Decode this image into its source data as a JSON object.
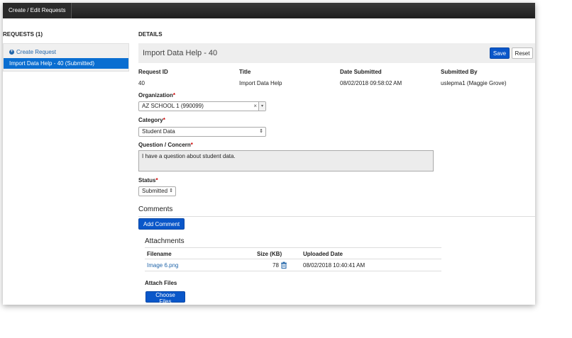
{
  "topbar": {
    "tab": "Create / Edit Requests"
  },
  "left": {
    "heading": "REQUESTS (1)",
    "create_link": "Create Request",
    "items": [
      "Import Data Help - 40 (Submitted)"
    ]
  },
  "details": {
    "heading": "DETAILS",
    "record_title": "Import Data Help - 40",
    "save_label": "Save",
    "reset_label": "Reset",
    "columns": {
      "request_id_label": "Request ID",
      "request_id_value": "40",
      "title_label": "Title",
      "title_value": "Import Data Help",
      "date_label": "Date Submitted",
      "date_value": "08/02/2018 09:58:02 AM",
      "by_label": "Submitted By",
      "by_value": "uslepma1 (Maggie Grove)"
    },
    "organization": {
      "label": "Organization",
      "value": "AZ SCHOOL 1 (990099)"
    },
    "category": {
      "label": "Category",
      "value": "Student Data"
    },
    "question": {
      "label": "Question / Concern",
      "value": "I have a question about student data."
    },
    "status": {
      "label": "Status",
      "value": "Submitted"
    },
    "required_mark": "*"
  },
  "comments": {
    "title": "Comments",
    "add_label": "Add Comment"
  },
  "attachments": {
    "title": "Attachments",
    "headers": {
      "filename": "Filename",
      "size": "Size (KB)",
      "uploaded": "Uploaded Date"
    },
    "rows": [
      {
        "filename": "Image 6.png",
        "size": "78",
        "uploaded": "08/02/2018 10:40:41 AM"
      }
    ],
    "attach_files_label": "Attach Files",
    "choose_files_label": "Choose Files"
  },
  "colors": {
    "accent": "#0a57c9",
    "selected": "#0a6ed1",
    "link": "#2266aa",
    "required": "#cc0000"
  }
}
